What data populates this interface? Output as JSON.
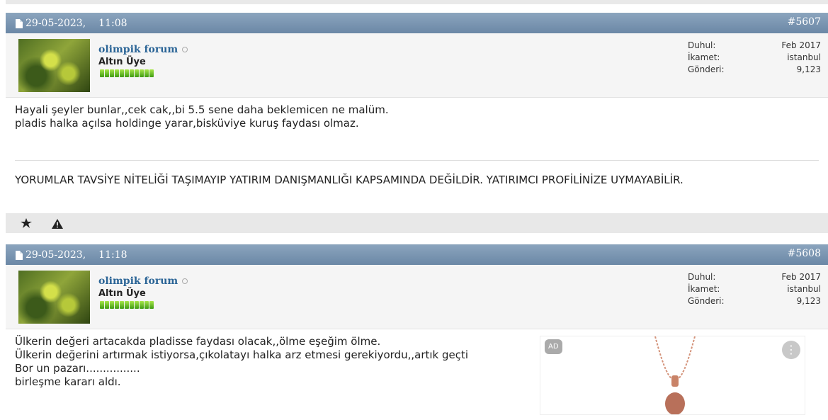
{
  "posts": [
    {
      "date": "29-05-2023,",
      "time": "11:08",
      "number": "#5607",
      "username": "olimpik forum",
      "rank": "Altın Üye",
      "info": [
        {
          "label": "Duhul:",
          "value": "Feb 2017"
        },
        {
          "label": "İkamet:",
          "value": "istanbul"
        },
        {
          "label": "Gönderi:",
          "value": "9,123"
        }
      ],
      "lines": [
        "Hayali şeyler bunlar,,cek cak,,bi 5.5 sene daha beklemicen ne malüm.",
        "pladis halka açılsa holdinge yarar,bisküviye kuruş faydası olmaz."
      ],
      "disclaimer": "YORUMLAR TAVSİYE NİTELİĞİ TAŞIMAYIP YATIRIM DANIŞMANLIĞI KAPSAMINDA DEĞİLDİR. YATIRIMCI PROFİLİNİZE UYMAYABİLİR."
    },
    {
      "date": "29-05-2023,",
      "time": "11:18",
      "number": "#5608",
      "username": "olimpik forum",
      "rank": "Altın Üye",
      "info": [
        {
          "label": "Duhul:",
          "value": "Feb 2017"
        },
        {
          "label": "İkamet:",
          "value": "istanbul"
        },
        {
          "label": "Gönderi:",
          "value": "9,123"
        }
      ],
      "lines": [
        "Ülkerin değeri artacakda pladisse faydası olacak,,ölme eşeğim ölme.",
        "Ülkerin değerini artırmak istiyorsa,çıkolatayı halka arz etmesi gerekiyordu,,artık geçti",
        "Bor un pazarı................",
        "birleşme kararı aldı."
      ],
      "ad_badge": "AD"
    }
  ],
  "icons": {
    "thanks": "star-icon",
    "report": "warning-icon",
    "post": "document-icon",
    "online": "status-dot-icon",
    "ad_menu": "more-vertical-icon"
  },
  "colors": {
    "header": "#7391ae",
    "username": "#2a6496",
    "rep_green": "#5fb820"
  }
}
